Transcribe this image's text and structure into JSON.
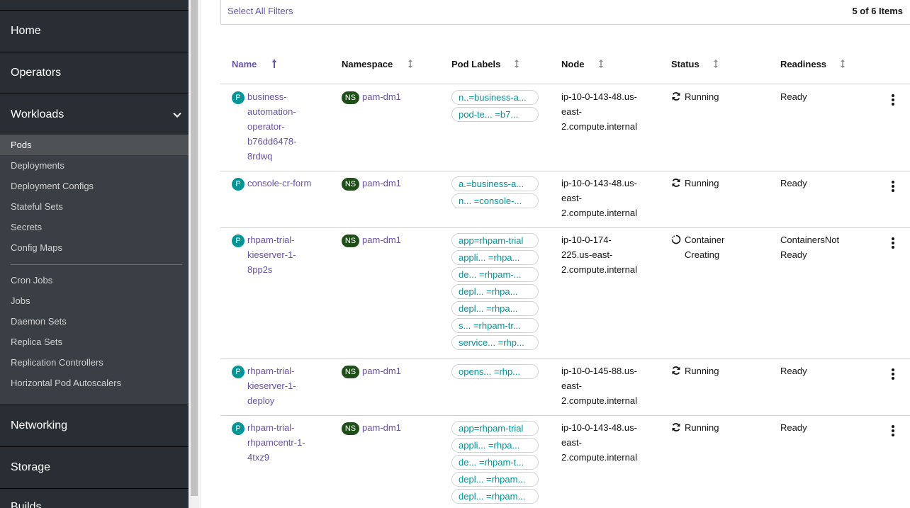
{
  "sidebar": {
    "home": "Home",
    "operators": "Operators",
    "workloads": "Workloads",
    "workload_items": [
      "Pods",
      "Deployments",
      "Deployment Configs",
      "Stateful Sets",
      "Secrets",
      "Config Maps",
      "Cron Jobs",
      "Jobs",
      "Daemon Sets",
      "Replica Sets",
      "Replication Controllers",
      "Horizontal Pod Autoscalers"
    ],
    "networking": "Networking",
    "storage": "Storage",
    "builds": "Builds"
  },
  "filter": {
    "select_all": "Select All Filters",
    "count": "5 of 6 Items"
  },
  "table": {
    "headers": [
      "Name",
      "Namespace",
      "Pod Labels",
      "Node",
      "Status",
      "Readiness"
    ],
    "rows": [
      {
        "badge": "P",
        "name_lines": [
          "business-",
          "automation-",
          "operator-",
          "b76dd6478-",
          "8rdwq"
        ],
        "ns_badge": "NS",
        "namespace": "pam-dm1",
        "labels": [
          "n..=business-a...",
          "pod-te...  =b7..."
        ],
        "node_lines": [
          "ip-10-0-143-48.us-",
          "east-",
          "2.compute.internal"
        ],
        "status_lines": [
          "Running"
        ],
        "status_icon": "sync-icon",
        "readiness_lines": [
          "Ready"
        ]
      },
      {
        "badge": "P",
        "name_lines": [
          "console-cr-form"
        ],
        "ns_badge": "NS",
        "namespace": "pam-dm1",
        "labels": [
          "a.=business-a...",
          "n...  =console-..."
        ],
        "node_lines": [
          "ip-10-0-143-48.us-",
          "east-",
          "2.compute.internal"
        ],
        "status_lines": [
          "Running"
        ],
        "status_icon": "sync-icon",
        "readiness_lines": [
          "Ready"
        ]
      },
      {
        "badge": "P",
        "name_lines": [
          "rhpam-trial-",
          "kieserver-1-",
          "8pp2s"
        ],
        "ns_badge": "NS",
        "namespace": "pam-dm1",
        "labels": [
          "app=rhpam-trial",
          "appli...  =rhpa...",
          "de...  =rhpam-...",
          "depl...  =rhpa...",
          "depl...  =rhpa...",
          "s...  =rhpam-tr...",
          "service...  =rhp..."
        ],
        "node_lines": [
          "ip-10-0-174-",
          "225.us-east-",
          "2.compute.internal"
        ],
        "status_lines": [
          "Container",
          "Creating"
        ],
        "status_icon": "spinner-icon",
        "readiness_lines": [
          "ContainersNot",
          "Ready"
        ]
      },
      {
        "badge": "P",
        "name_lines": [
          "rhpam-trial-",
          "kieserver-1-",
          "deploy"
        ],
        "ns_badge": "NS",
        "namespace": "pam-dm1",
        "labels": [
          "opens...   =rhp..."
        ],
        "node_lines": [
          "ip-10-0-145-88.us-",
          "east-",
          "2.compute.internal"
        ],
        "status_lines": [
          "Running"
        ],
        "status_icon": "sync-icon",
        "readiness_lines": [
          "Ready"
        ]
      },
      {
        "badge": "P",
        "name_lines": [
          "rhpam-trial-",
          "rhpamcentr-1-",
          "4txz9"
        ],
        "ns_badge": "NS",
        "namespace": "pam-dm1",
        "labels": [
          "app=rhpam-trial",
          "appli...  =rhpa...",
          "de...  =rhpam-t...",
          "depl...  =rhpam...",
          "depl...  =rhpam..."
        ],
        "node_lines": [
          "ip-10-0-143-48.us-",
          "east-",
          "2.compute.internal"
        ],
        "status_lines": [
          "Running"
        ],
        "status_icon": "sync-icon",
        "readiness_lines": [
          "Ready"
        ]
      }
    ]
  },
  "colors": {
    "link": "#6753ac",
    "label": "#009596",
    "ns_badge": "#1e4f18",
    "pod_badge": "#009596",
    "sidebar_bg": "#292e34"
  }
}
